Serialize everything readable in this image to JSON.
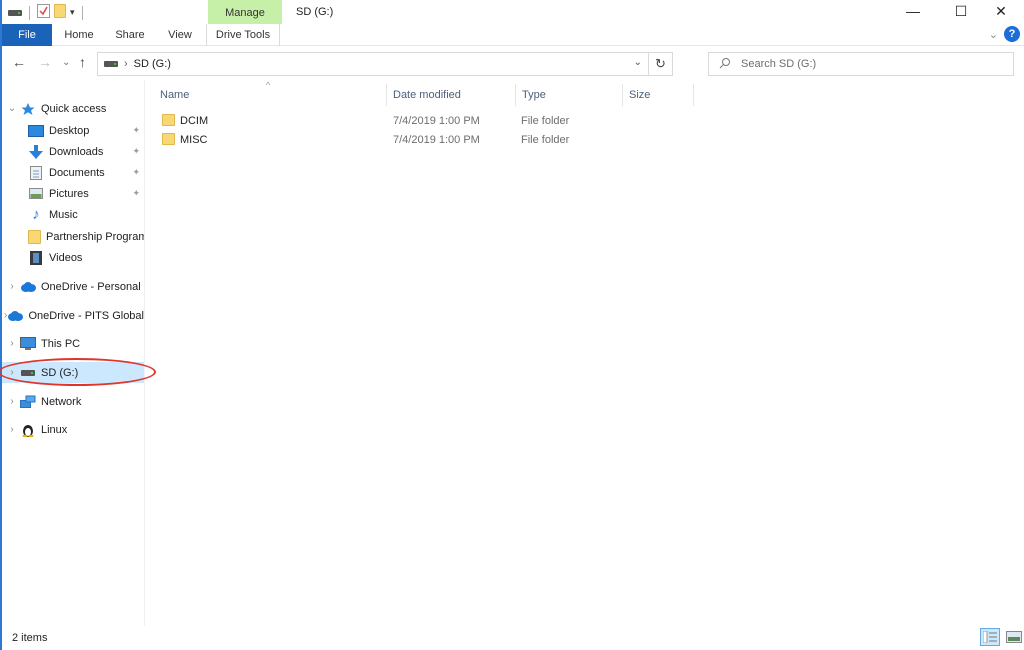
{
  "window": {
    "title": "SD (G:)",
    "contextual_tab_group": "Manage",
    "controls": {
      "minimize": "—",
      "maximize": "☐",
      "close": "✕"
    }
  },
  "quick_access_toolbar": {
    "icons": [
      "drive-icon",
      "properties-icon",
      "new-folder-icon",
      "customize-dropdown-icon"
    ]
  },
  "ribbon": {
    "tabs": [
      {
        "label": "File",
        "active": true
      },
      {
        "label": "Home"
      },
      {
        "label": "Share"
      },
      {
        "label": "View"
      },
      {
        "label": "Drive Tools"
      }
    ],
    "help_label": "?",
    "expand_glyph": "⌄"
  },
  "navigation": {
    "back": "←",
    "forward": "→",
    "recent": "⌄",
    "up": "↑",
    "breadcrumb": [
      {
        "label": "SD (G:)"
      }
    ],
    "breadcrumb_sep": "›",
    "refresh": "↻",
    "dropdown": "⌄",
    "search_placeholder": "Search SD (G:)"
  },
  "sidebar": {
    "items": [
      {
        "label": "Quick access",
        "expander": "⌄",
        "icon": "star-icon"
      },
      {
        "label": "Desktop",
        "icon": "desktop-icon",
        "pinned": true
      },
      {
        "label": "Downloads",
        "icon": "download-icon",
        "pinned": true
      },
      {
        "label": "Documents",
        "icon": "documents-icon",
        "pinned": true
      },
      {
        "label": "Pictures",
        "icon": "pictures-icon",
        "pinned": true
      },
      {
        "label": "Music",
        "icon": "music-icon"
      },
      {
        "label": "Partnership Program",
        "icon": "folder-icon"
      },
      {
        "label": "Videos",
        "icon": "videos-icon"
      },
      {
        "label": "OneDrive - Personal",
        "expander": "›",
        "icon": "cloud-icon"
      },
      {
        "label": "OneDrive - PITS Global",
        "expander": "›",
        "icon": "cloud-icon"
      },
      {
        "label": "This PC",
        "expander": "›",
        "icon": "computer-icon"
      },
      {
        "label": "SD (G:)",
        "expander": "›",
        "icon": "drive-icon",
        "selected": true
      },
      {
        "label": "Network",
        "expander": "›",
        "icon": "network-icon"
      },
      {
        "label": "Linux",
        "expander": "›",
        "icon": "linux-icon"
      }
    ],
    "pin_glyph": "📌"
  },
  "file_list": {
    "columns": [
      "Name",
      "Date modified",
      "Type",
      "Size"
    ],
    "sort_indicator": "^",
    "rows": [
      {
        "name": "DCIM",
        "date_modified": "7/4/2019 1:00 PM",
        "type": "File folder",
        "size": ""
      },
      {
        "name": "MISC",
        "date_modified": "7/4/2019 1:00 PM",
        "type": "File folder",
        "size": ""
      }
    ]
  },
  "status_bar": {
    "item_count": "2 items",
    "views": [
      "details-view",
      "large-icons-view"
    ]
  },
  "colors": {
    "accent": "#1b63b9",
    "manage_tab": "#c6efa8",
    "selection": "#cce8ff",
    "annotation_ellipse": "#e0352b"
  }
}
